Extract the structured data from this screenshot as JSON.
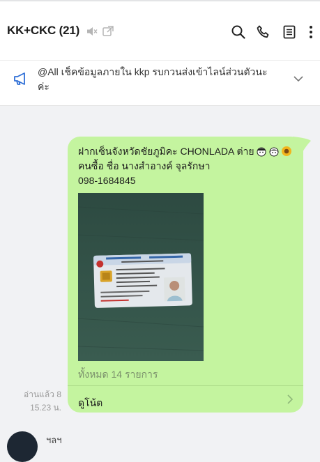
{
  "header": {
    "title": "KK+CKC (21)"
  },
  "icons": {
    "mute": "speaker-muted-icon",
    "popout": "popout-window-icon",
    "search": "search-icon",
    "call": "phone-icon",
    "notes": "notes-icon",
    "more": "more-vertical-icon",
    "announcement": "megaphone-icon",
    "expand": "chevron-down-icon",
    "note_link": "chevron-right-icon"
  },
  "announcement": {
    "text": "@All  เช็คข้อมูลภายใน kkp รบกวนส่งเข้าไลน์ส่วนตัวนะค่ะ"
  },
  "message": {
    "line1": "ฝากเซ็นจังหวัดชัยภูมิคะ CHONLADA ต่าย",
    "line2": "คนซื้อ ชื่อ นางสำอางค์ จุลรักษา",
    "line3": "098-1684845",
    "photo_count": "ทั้งหมด 14 รายการ",
    "note_link": "ดูโน้ต",
    "read_status": "อ่านแล้ว 8",
    "time": "15.23 น."
  },
  "next_message": {
    "sender_partial": "ฯลฯ"
  },
  "colors": {
    "bubble": "#c4f49f",
    "background": "#f1f2f4",
    "accent_blue": "#2f6fd6"
  }
}
